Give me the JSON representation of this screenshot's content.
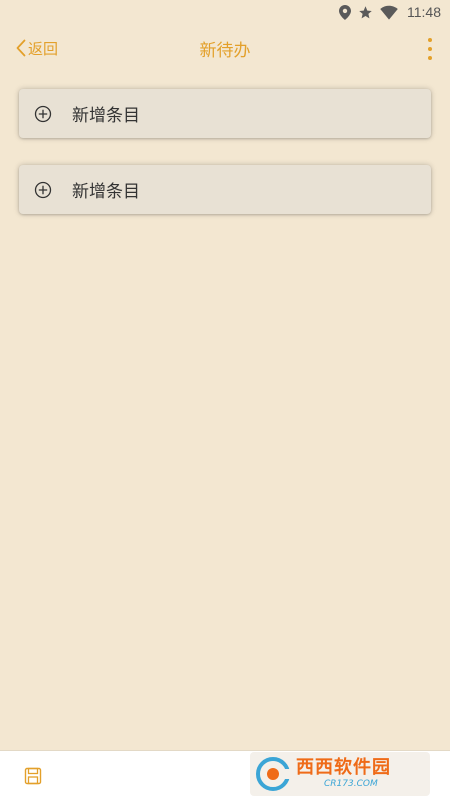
{
  "status_bar": {
    "time": "11:48",
    "icons": [
      "location-icon",
      "star-icon",
      "wifi-icon"
    ]
  },
  "header": {
    "back_label": "返回",
    "title": "新待办",
    "more_icon": "more-vert-icon"
  },
  "items": [
    {
      "label": "新增条目",
      "icon": "add-circle-icon"
    },
    {
      "label": "新增条目",
      "icon": "add-circle-icon"
    }
  ],
  "bottom_bar": {
    "save_icon": "save-icon"
  },
  "watermark": {
    "main_text": "西西软件园",
    "sub_text": "CR173.COM"
  },
  "colors": {
    "accent": "#e3a02a",
    "background": "#f3e7d1",
    "card": "#e8e1d4"
  }
}
